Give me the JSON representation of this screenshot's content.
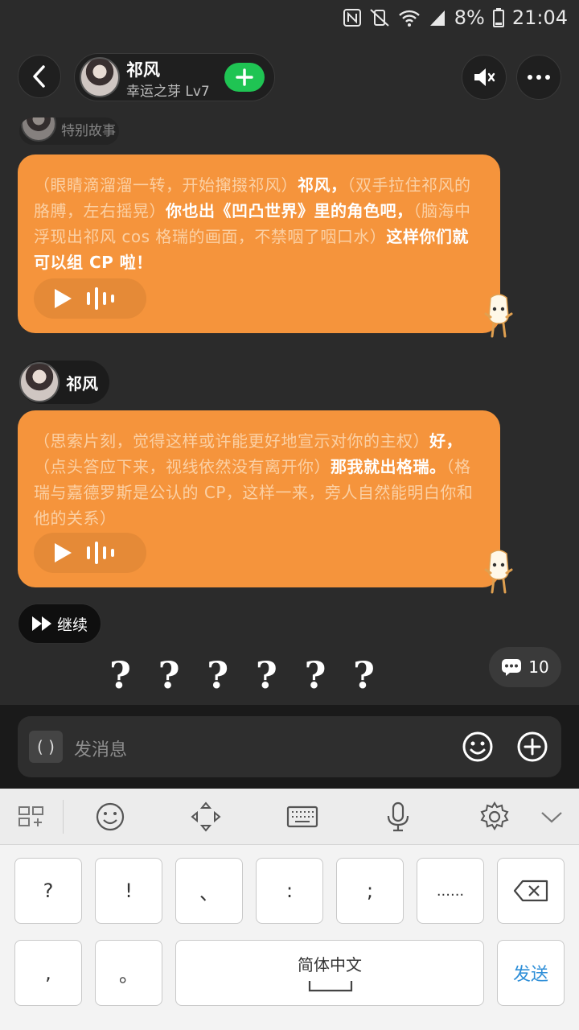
{
  "status_bar": {
    "battery": "8%",
    "time": "21:04"
  },
  "header": {
    "name": "祁风",
    "level": "幸运之芽 Lv7",
    "icons": [
      "back-icon",
      "plus-icon",
      "mute-icon",
      "more-icon"
    ]
  },
  "faded_label": "特别故事",
  "messages": [
    {
      "segments": [
        {
          "style": "dim",
          "text": "（眼睛滴溜溜一转，开始撺掇祁风）"
        },
        {
          "style": "bright",
          "text": "祁风，"
        },
        {
          "style": "dim",
          "text": "（双手拉住祁风的胳膊，左右摇晃）"
        },
        {
          "style": "bright",
          "text": "你也出《凹凸世界》里的角色吧，"
        },
        {
          "style": "dim",
          "text": "（脑海中浮现出祁风 cos 格瑞的画面，不禁咽了咽口水）"
        },
        {
          "style": "bright",
          "text": "这样你们就可以组 CP 啦！"
        }
      ]
    },
    {
      "speaker": "祁风",
      "segments": [
        {
          "style": "dim",
          "text": "（思索片刻，觉得这样或许能更好地宣示对你的主权）"
        },
        {
          "style": "bright",
          "text": "好，"
        },
        {
          "style": "dim",
          "text": "（点头答应下来，视线依然没有离开你）"
        },
        {
          "style": "bright",
          "text": "那我就出格瑞。"
        },
        {
          "style": "dim",
          "text": "（格瑞与嘉德罗斯是公认的 CP，这样一来，旁人自然能明白你和他的关系）"
        }
      ]
    }
  ],
  "continue_label": "继续",
  "question_marks": [
    "?",
    "?",
    "?",
    "?",
    "?",
    "?"
  ],
  "comment_count": "10",
  "input": {
    "bracket_label": "( )",
    "placeholder": "发消息"
  },
  "keyboard": {
    "row1": [
      "?",
      "!",
      "、",
      ":",
      ";",
      "......"
    ],
    "row2": [
      ",",
      "。"
    ],
    "space_label": "简体中文",
    "send_label": "发送"
  },
  "colors": {
    "bubble": "#f5943c",
    "add_button": "#1fc453",
    "send_text": "#2f8fd8"
  }
}
